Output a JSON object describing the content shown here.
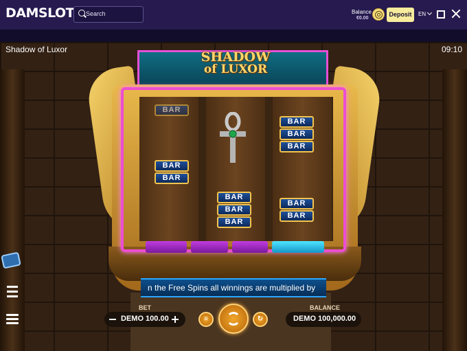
{
  "topbar": {
    "logo": "DAMSLOTS",
    "search_placeholder": "Search",
    "balance_label": "Balance",
    "balance_value": "€0.00",
    "deposit_label": "Deposit",
    "language": "EN"
  },
  "game": {
    "title": "Shadow of Luxor",
    "clock": "09:10",
    "logo_line1": "SHADOW",
    "logo_line2": "of LUXOR",
    "symbol_text": "BAR",
    "ticker": "n the Free Spins all winnings are multiplied by",
    "bet_label": "BET",
    "bet_value": "DEMO 100.00",
    "balance_label": "BALANCE",
    "balance_value": "DEMO 100,000.00"
  },
  "colors": {
    "topbar": "#261a4f",
    "deposit": "#f7ec9b",
    "neon": "#ec4ed2",
    "gold": "#e9b94b"
  },
  "icons": [
    "search-icon",
    "fingerprint-icon",
    "chevron-down-icon",
    "fullscreen-icon",
    "close-icon",
    "list-icon",
    "hamburger-icon",
    "spin-icon",
    "autoplay-icon",
    "turbo-icon",
    "ankh-icon"
  ]
}
